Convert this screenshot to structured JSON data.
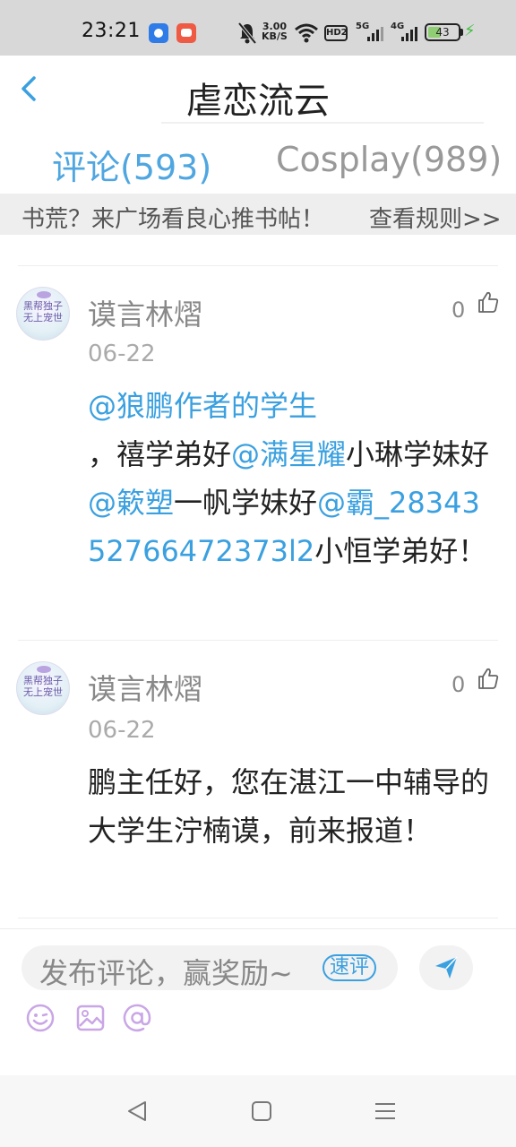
{
  "status_bar": {
    "time": "23:21",
    "net_speed_value": "3.00",
    "net_speed_unit": "KB/S",
    "hd_label": "HD2",
    "sig1_label": "5G",
    "sig2_label": "4G",
    "battery": "43"
  },
  "header": {
    "title": "虐恋流云"
  },
  "tabs": [
    {
      "label": "评论(593)",
      "active": true
    },
    {
      "label": "Cosplay(989)",
      "active": false
    }
  ],
  "banner": {
    "text": "书荒？来广场看良心推书帖！",
    "link": "查看规则>>"
  },
  "comments": {
    "partial_text": "",
    "items": [
      {
        "avatar_text": "黑帮独子\n无上宠世",
        "username": "谟言林熠",
        "date": "06-22",
        "likes": "0",
        "content": {
          "m1": "@狼鹏作者的学生",
          "t1": "，禧学弟好",
          "m2": "@满星耀",
          "t2": "小琳学妹好",
          "m3": "@簌塑",
          "t3": "一帆学妹好",
          "m4": "@霸_2834352766472373l2",
          "t4": "小恒学弟好！"
        }
      },
      {
        "avatar_text": "黑帮独子\n无上宠世",
        "username": "谟言林熠",
        "date": "06-22",
        "likes": "0",
        "content": {
          "text": "鹏主任好，您在湛江一中辅导的大学生泞楠谟，前来报道！"
        }
      }
    ]
  },
  "composer": {
    "placeholder": "发布评论，赢奖励~",
    "quick_badge": "速评"
  },
  "colors": {
    "accent": "#4fa6e0",
    "mention": "#3aa0e0",
    "tool_icon": "#c9a6e6"
  }
}
